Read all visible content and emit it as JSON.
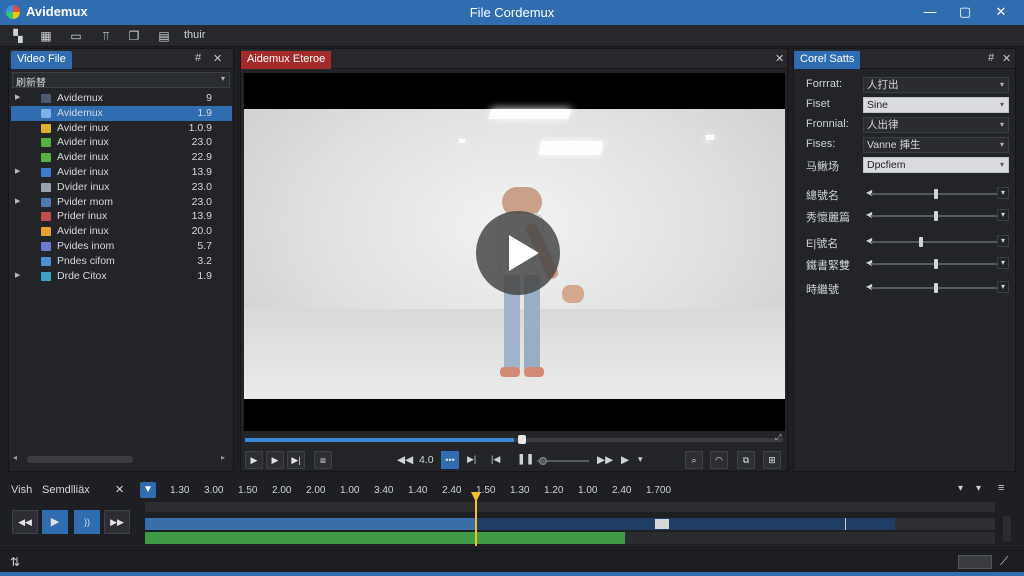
{
  "titlebar": {
    "app_name": "Avidemux",
    "window_title": "File Cordemux",
    "min_icon": "minimize-icon",
    "max_icon": "maximize-icon",
    "close_icon": "close-icon"
  },
  "toolbar": {
    "label": "thuir",
    "icons": [
      "open-icon",
      "info-icon",
      "save-icon",
      "copy-icon",
      "properties-icon"
    ]
  },
  "file_panel": {
    "tab": "Video File",
    "pin": "#",
    "close": "✕",
    "combo": "刷新替",
    "rows": [
      {
        "name": "Avidemux",
        "size": "9",
        "color": "#4a5a75",
        "expanded": true
      },
      {
        "name": "Avidemux",
        "size": "1.9",
        "color": "#7fb0e8",
        "selected": true
      },
      {
        "name": "Avider inux",
        "size": "1.0.9",
        "color": "#e0b030"
      },
      {
        "name": "Avider inux",
        "size": "23.0",
        "color": "#58b045"
      },
      {
        "name": "Avider inux",
        "size": "22.9",
        "color": "#58b045"
      },
      {
        "name": "Avider inux",
        "size": "13.9",
        "color": "#3e7ad0",
        "arrow": true
      },
      {
        "name": "Dvider inux",
        "size": "23.0",
        "color": "#9aa3ad"
      },
      {
        "name": "Pvider mom",
        "size": "23.0",
        "color": "#4a7ab0",
        "arrow": true
      },
      {
        "name": "Prider inux",
        "size": "13.9",
        "color": "#c05050"
      },
      {
        "name": "Avider inux",
        "size": "20.0",
        "color": "#e8a030"
      },
      {
        "name": "Pvides inom",
        "size": "5.7",
        "color": "#6a7bd0"
      },
      {
        "name": "Pndes cifom",
        "size": "3.2",
        "color": "#5090d0"
      },
      {
        "name": "Drde Citox",
        "size": "1.9",
        "color": "#40a0c0",
        "arrow": true
      }
    ]
  },
  "video_panel": {
    "tab": "Aidemux Eteroe",
    "close": "✕",
    "time_display": "4.0",
    "progress": 0.5
  },
  "props_panel": {
    "tab": "Corel Satts",
    "pin": "#",
    "close": "✕",
    "fields": [
      {
        "label": "Forrrat:",
        "value": "人打出",
        "light": false
      },
      {
        "label": "Fiset",
        "value": "Sine",
        "light": true
      },
      {
        "label": "Fronnial:",
        "value": "人出律",
        "light": false
      },
      {
        "label": "Fises:",
        "value": "Vanne 挿生",
        "light": false
      },
      {
        "label": "马鳅场",
        "value": "Dpcfiem",
        "light": true
      }
    ],
    "sliders": [
      {
        "label": "總號名",
        "level": 0.5
      },
      {
        "label": "秀懷麗篇",
        "level": 0.5
      },
      {
        "label": "E|號名",
        "level": 0.38
      },
      {
        "label": "鐵書緊雙",
        "level": 0.5
      },
      {
        "label": "時繼號",
        "level": 0.5
      }
    ]
  },
  "timeline": {
    "label1": "Vish",
    "label2": "Semdlliäx",
    "close": "✕",
    "ticks": [
      "1.30",
      "3.00",
      "1.50",
      "2.00",
      "2.00",
      "1.00",
      "3.40",
      "1.40",
      "2.40",
      "1.50",
      "1.30",
      "1.20",
      "1.00",
      "2.40",
      "1.700"
    ],
    "playhead": 0.44,
    "buttons": [
      "rewind-icon",
      "play-icon",
      "step-icon",
      "forward-icon"
    ]
  },
  "colors": {
    "accent": "#2f6db0",
    "track_blue": "#3a6ea8",
    "track_green": "#3f9b45",
    "playhead": "#f0c030"
  }
}
